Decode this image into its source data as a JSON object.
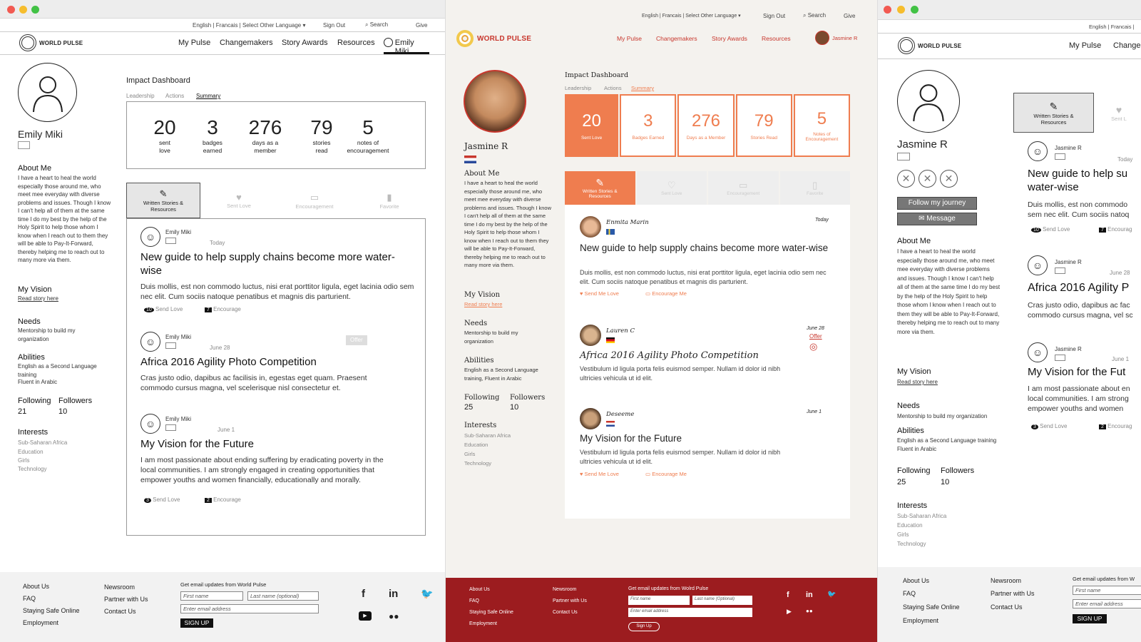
{
  "panel1": {
    "lang_bar": "English | Francais | Select Other Language",
    "sign_out": "Sign Out",
    "search": "Search",
    "give": "Give",
    "logo": "WORLD PULSE",
    "nav": [
      "My Pulse",
      "Changemakers",
      "Story Awards",
      "Resources"
    ],
    "user_name": "Emily Miki",
    "profile_name": "Emily Miki",
    "about_title": "About Me",
    "about_text": "I have a heart to heal the world especially those around me, who meet mee everyday with diverse problems and issues. Though I know I can't help all of them at the same time I do my best by the help of the Holy Spirit to help those whom I know when I reach out to them they will be able to Pay-It-Forward, thereby helping me to reach out to many more via them.",
    "vision_title": "My Vision",
    "vision_link": "Read story here",
    "needs_title": "Needs",
    "needs_text": "Mentorship to build my organization",
    "abilities_title": "Abilities",
    "abilities_text": "English as a Second Language training",
    "abilities_text2": "Fluent in Arabic",
    "following_label": "Following",
    "followers_label": "Followers",
    "following": "21",
    "followers": "10",
    "interests_title": "Interests",
    "interests": [
      "Sub-Saharan Africa",
      "Education",
      "Girls",
      "Technology"
    ],
    "dashboard_title": "Impact Dashboard",
    "dash_tabs": [
      "Leadership",
      "Actions",
      "Summary"
    ],
    "stats": [
      {
        "num": "20",
        "l1": "sent",
        "l2": "love"
      },
      {
        "num": "3",
        "l1": "badges",
        "l2": "earned"
      },
      {
        "num": "276",
        "l1": "days as a",
        "l2": "member"
      },
      {
        "num": "79",
        "l1": "stories",
        "l2": "read"
      },
      {
        "num": "5",
        "l1": "notes of",
        "l2": "encouragement"
      }
    ],
    "content_tabs": [
      "Written Stories & Resources",
      "Sent Love",
      "Encouragement",
      "Favorite"
    ],
    "posts": [
      {
        "author": "Emily Miki",
        "date": "Today",
        "title": "New guide to help supply chains become more water-wise",
        "body": "Duis mollis, est non commodo luctus, nisi erat porttitor ligula, eget lacinia odio sem nec elit. Cum sociis natoque penatibus et magnis dis parturient.",
        "love_count": "10",
        "love_label": "Send Love",
        "enc_count": "7",
        "enc_label": "Encourage",
        "badge": ""
      },
      {
        "author": "Emily Miki",
        "date": "June 28",
        "title": "Africa 2016 Agility Photo Competition",
        "body": "Cras justo odio, dapibus ac facilisis in, egestas eget quam. Praesent commodo cursus magna, vel scelerisque nisl consectetur et.",
        "love_count": "",
        "love_label": "",
        "enc_count": "",
        "enc_label": "",
        "badge": "Offer"
      },
      {
        "author": "Emily Miki",
        "date": "June 1",
        "title": "My Vision for the Future",
        "body": "I am most passionate about ending suffering by eradicating poverty in the local communities. I am strongly engaged in creating opportunities that empower youths and women financially, educationally and morally.",
        "love_count": "3",
        "love_label": "Send  Love",
        "enc_count": "2",
        "enc_label": "Encourage",
        "badge": ""
      }
    ],
    "footer": {
      "col1": [
        "About Us",
        "FAQ",
        "Staying Safe Online",
        "Employment"
      ],
      "col2": [
        "Newsroom",
        "Partner with Us",
        "Contact Us"
      ],
      "email_title": "Get email updates from World Pulse",
      "first_ph": "First name",
      "last_ph": "Last name (optional)",
      "email_ph": "Enter email address",
      "signup": "SIGN UP"
    }
  },
  "panel2": {
    "lang_bar": "English | Francais | Select Other Language",
    "sign_out": "Sign Out",
    "search": "Search",
    "give": "Give",
    "logo": "WORLD PULSE",
    "nav": [
      "My Pulse",
      "Changemakers",
      "Story Awards",
      "Resources"
    ],
    "user_name": "Jasmine R",
    "profile_name": "Jasmine R",
    "about_title": "About Me",
    "about_text": "I have a heart to heal the world especially those around me, who meet mee everyday with diverse problems and issues. Though I know I can't help all of them at the same time I do my best by the help of the Holy Spirit to help those whom I know when I reach out to them they will be able to Pay-It-Forward, thereby helping me to reach out to many more via them.",
    "vision_title": "My Vision",
    "vision_link": "Read story here",
    "needs_title": "Needs",
    "needs_text": "Mentorship to build my organization",
    "abilities_title": "Abilities",
    "abilities_text": "English as a Second Language training, Fluent in Arabic",
    "following_label": "Following",
    "followers_label": "Followers",
    "following": "25",
    "followers": "10",
    "interests_title": "Interests",
    "interests": [
      "Sub-Saharan Africa",
      "Education",
      "Girls",
      "Technology"
    ],
    "dashboard_title": "Impact Dashboard",
    "dash_tabs": [
      "Leadership",
      "Actions",
      "Summary"
    ],
    "stats": [
      {
        "num": "20",
        "lbl": "Sent Love"
      },
      {
        "num": "3",
        "lbl": "Badges Earned"
      },
      {
        "num": "276",
        "lbl": "Days as a Member"
      },
      {
        "num": "79",
        "lbl": "Stories Read"
      },
      {
        "num": "5",
        "lbl": "Notes of Encouragement"
      }
    ],
    "content_tabs": [
      "Written Stories & Resources",
      "Sent Love",
      "Encouragement",
      "Favorite"
    ],
    "posts": [
      {
        "author": "Enmita Marin",
        "date": "Today",
        "title": "New guide to help supply chains become more water-wise",
        "body": "Duis mollis, est non commodo luctus, nisi erat porttitor ligula, eget lacinia odio sem nec elit. Cum sociis natoque penatibus et magnis dis parturient.",
        "love": "Send Me Love",
        "enc": "Encourage Me",
        "badge": ""
      },
      {
        "author": "Lauren C",
        "date": "June 28",
        "title": "Africa 2016 Agility Photo Competition",
        "body": "Vestibulum id ligula porta felis euismod semper. Nullam id dolor id nibh ultricies vehicula ut id elit.",
        "love": "",
        "enc": "",
        "badge": "Offer"
      },
      {
        "author": "Deseeme",
        "date": "June 1",
        "title": "My Vision for the Future",
        "body": "Vestibulum id ligula porta felis euismod semper. Nullam id dolor id nibh ultricies vehicula ut id elit.",
        "love": "Send Me Love",
        "enc": "Encourage Me",
        "badge": ""
      }
    ],
    "footer": {
      "col1": [
        "About Us",
        "FAQ",
        "Staying Safe Online",
        "Employment"
      ],
      "col2": [
        "Newsroom",
        "Partner with Us",
        "Contact Us"
      ],
      "email_title": "Get email updates from Wolrd Pulse",
      "first_ph": "First name",
      "last_ph": "Last name (Optional)",
      "email_ph": "Enter email address",
      "signup": "Sign Up"
    }
  },
  "panel3": {
    "lang_bar": "English | Francais |",
    "logo": "WORLD PULSE",
    "nav": [
      "My Pulse",
      "Changem"
    ],
    "profile_name": "Jasmine R",
    "follow_btn": "Follow  my journey",
    "message_btn": "Message",
    "about_title": "About Me",
    "about_text": "I have a heart to heal the world especially those around me, who meet mee everyday with diverse problems and issues. Though I know I can't help all of them at the same time I do my best by the help of the Holy Spirit to help those whom I know when I reach out to them they will be able to Pay-It-Forward, thereby helping me to reach out to many more via them.",
    "vision_title": "My Vision",
    "vision_link": "Read story here",
    "needs_title": "Needs",
    "needs_text": "Mentorship to build my organization",
    "abilities_title": "Abilities",
    "abilities_text": "English as a Second Language training",
    "abilities_text2": "Fluent in Arabic",
    "following_label": "Following",
    "followers_label": "Followers",
    "following": "25",
    "followers": "10",
    "interests_title": "Interests",
    "interests": [
      "Sub-Saharan Africa",
      "Education",
      "Girls",
      "Technology"
    ],
    "tab_active": "Written Stories & Resources",
    "tab_next": "Sent L",
    "posts": [
      {
        "author": "Jasmine R",
        "date": "Today",
        "title": "New guide to help su water-wise",
        "body": "Duis mollis, est non commodo sem nec elit. Cum sociis natoq",
        "love_count": "10",
        "love_label": "Send Love",
        "enc_count": "7",
        "enc_label": "Encourag"
      },
      {
        "author": "Jasmine R",
        "date": "June 28",
        "title": "Africa 2016 Agility P",
        "body": "Cras justo odio, dapibus ac fac commodo cursus magna, vel sc",
        "love_count": "",
        "love_label": "",
        "enc_count": "",
        "enc_label": ""
      },
      {
        "author": "Jasmine R",
        "date": "June 1",
        "title": "My Vision for the Fut",
        "body": "I am most passionate about en local communities. I am strong empower youths and women",
        "love_count": "3",
        "love_label": "Send  Love",
        "enc_count": "2",
        "enc_label": "Encourag"
      }
    ],
    "footer": {
      "col1": [
        "About Us",
        "FAQ",
        "Staying Safe Online",
        "Employment"
      ],
      "col2": [
        "Newsroom",
        "Partner with Us",
        "Contact Us"
      ],
      "email_title": "Get email updates from W",
      "first_ph": "First name",
      "email_ph": "Enter email address",
      "signup": "SIGN UP"
    }
  },
  "colors": {
    "accent_orange": "#ef7d4f",
    "footer_red": "#9c1c1f"
  }
}
